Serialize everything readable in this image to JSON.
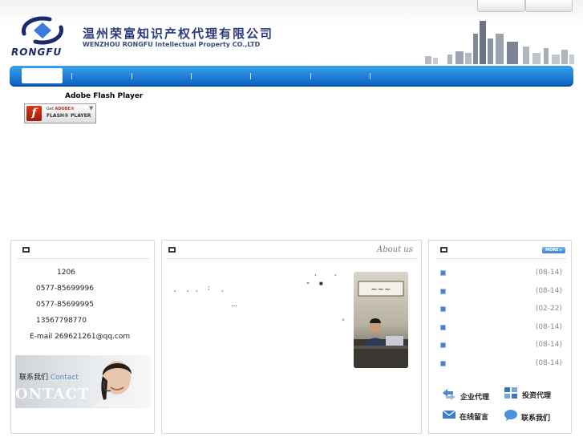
{
  "header": {
    "logo_text": "RONGFU",
    "company_cn": "温州荣富知识产权代理有限公司",
    "company_en": "WENZHOU RONGFU Intellectual Property CO.,LTD"
  },
  "flash": {
    "title": "Adobe Flash Player",
    "button_get": "Get",
    "button_brand": "ADOBE®",
    "button_product": "FLASH® PLAYER"
  },
  "contact": {
    "lines": [
      "1206",
      "0577-85699996",
      "0577-85699995",
      "13567798770",
      "E-mail 269621261@qq.com"
    ],
    "banner_cn": "联系我们",
    "banner_en": "Contact",
    "banner_big": "ONTACT"
  },
  "about": {
    "title": "About us",
    "punct": [
      ",",
      ",",
      "“",
      "■",
      ",",
      ",",
      ",",
      ";",
      ","
    ],
    "ellipsis": "...",
    "more": "»"
  },
  "news": {
    "more_label": "MORE ▸",
    "dates": [
      "(08-14)",
      "(08-14)",
      "(02-22)",
      "(08-14)",
      "(08-14)",
      "(08-14)"
    ]
  },
  "services": [
    {
      "label": "企业代理",
      "icon": "arrows-icon"
    },
    {
      "label": "投资代理",
      "icon": "grid-icon"
    },
    {
      "label": "在线留言",
      "icon": "mail-icon"
    },
    {
      "label": "联系我们",
      "icon": "chat-bubble-icon"
    }
  ],
  "colors": {
    "nav_top": "#3aa0ea",
    "nav_bottom": "#0a62c6",
    "brand_navy": "#2a3a7a"
  }
}
